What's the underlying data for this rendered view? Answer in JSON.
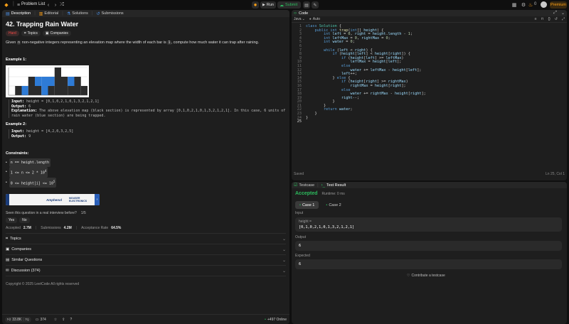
{
  "topbar": {
    "problem_list": "Problem List",
    "run": "Run",
    "submit": "Submit",
    "points": "0",
    "premium": "Premium"
  },
  "left_tabs": [
    "Description",
    "Editorial",
    "Solutions",
    "Submissions"
  ],
  "problem": {
    "title": "42. Trapping Rain Water",
    "difficulty": "Hard",
    "topics": "Topics",
    "companies": "Companies",
    "desc_pre": "Given",
    "desc_n": "n",
    "desc_mid": "non-negative integers representing an elevation map where the width of each bar is",
    "desc_one": "1",
    "desc_post": ", compute how much water it can trap after raining.",
    "example1_title": "Example 1:",
    "ex1_input_label": "Input:",
    "ex1_input": "height = [0,1,0,2,1,0,1,3,2,1,2,1]",
    "ex1_output_label": "Output:",
    "ex1_output": "6",
    "ex1_expl_label": "Explanation:",
    "ex1_expl": "The above elevation map (black section) is represented by array [0,1,0,2,1,0,1,3,2,1,2,1]. In this case, 6 units of rain water (blue section) are being trapped.",
    "example2_title": "Example 2:",
    "ex2_input_label": "Input:",
    "ex2_input": "height = [4,2,0,3,2,5]",
    "ex2_output_label": "Output:",
    "ex2_output": "9",
    "constraints_title": "Constraints:",
    "c1": "n == height.length",
    "c2_pre": "1 <= n <= 2 * 10",
    "c2_sup": "4",
    "c3_pre": "0 <= height[i] <= 10",
    "c3_sup": "5",
    "ad_text": "Amphenol",
    "ad_text2": "MOUSER ELECTRONICS",
    "interview_q": "Seen this question in a real interview before?",
    "interview_count": "1/5",
    "yes": "Yes",
    "no": "No",
    "accepted_label": "Accepted",
    "accepted_val": "2.7M",
    "submissions_label": "Submissions",
    "submissions_val": "4.2M",
    "rate_label": "Acceptance Rate",
    "rate_val": "64.5%",
    "sections": [
      "Topics",
      "Companies",
      "Similar Questions",
      "Discussion (374)"
    ],
    "copyright": "Copyright © 2025 LeetCode All rights reserved"
  },
  "elevation_chart": {
    "heights": [
      0,
      1,
      0,
      2,
      1,
      0,
      1,
      3,
      2,
      1,
      2,
      1
    ],
    "water": [
      0,
      0,
      1,
      0,
      1,
      2,
      1,
      0,
      0,
      1,
      0,
      0
    ],
    "ylim": [
      0,
      3
    ]
  },
  "bottom": {
    "likes": "33.8K",
    "comments": "374",
    "online": "+497 Online"
  },
  "code": {
    "title": "Code",
    "lang": "Java",
    "auto": "Auto",
    "saved": "Saved",
    "position": "Ln 25, Col 1",
    "lines": [
      "class Solution {",
      "    public int trap(int[] height) {",
      "        int left = 0, right = height.length - 1;",
      "        int leftMax = 0, rightMax = 0;",
      "        int water = 0;",
      "",
      "        while (left < right) {",
      "            if (height[left] < height[right]) {",
      "                if (height[left] >= leftMax)",
      "                    leftMax = height[left];",
      "                else",
      "                    water += leftMax - height[left];",
      "                left++;",
      "            } else {",
      "                if (height[right] >= rightMax)",
      "                    rightMax = height[right];",
      "                else",
      "                    water += rightMax - height[right];",
      "                right--;",
      "            }",
      "        }",
      "        return water;",
      "    }",
      "}",
      ""
    ]
  },
  "test": {
    "tab1": "Testcase",
    "tab2": "Test Result",
    "status": "Accepted",
    "runtime": "Runtime: 0 ms",
    "case1": "Case 1",
    "case2": "Case 2",
    "input_label": "Input",
    "param": "height =",
    "input_val": "[0,1,0,2,1,0,1,3,2,1,2,1]",
    "output_label": "Output",
    "output_val": "6",
    "expected_label": "Expected",
    "expected_val": "6",
    "contribute": "Contribute a testcase"
  },
  "colors": {
    "accent": "#2cbb5d",
    "orange": "#ffa116",
    "hard": "#ef4743",
    "water": "#2e7bd6"
  }
}
